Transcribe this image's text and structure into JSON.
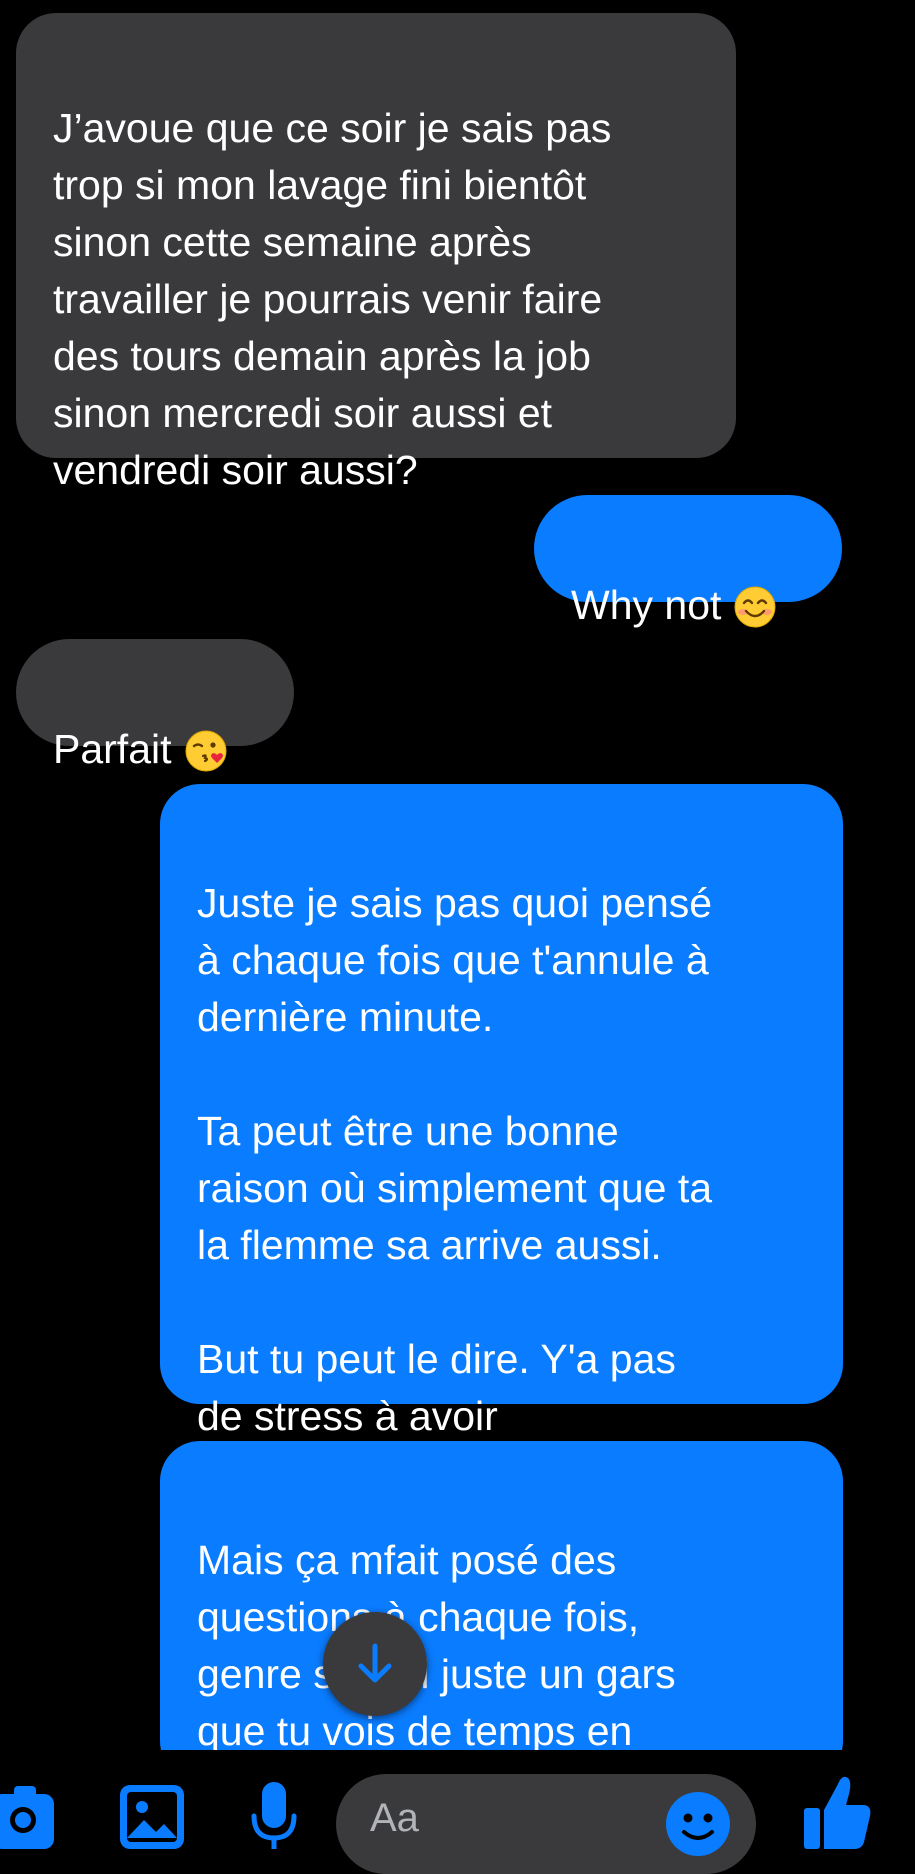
{
  "messages": [
    {
      "id": "m1",
      "direction": "incoming",
      "text": "J’avoue que ce soir je sais pas\ntrop si mon lavage fini bientôt\nsinon cette semaine après\ntravailler je pourrais venir faire\ndes tours demain après la job\nsinon mercredi soir aussi et\nvendredi soir aussi?"
    },
    {
      "id": "m2",
      "direction": "outgoing",
      "text": "Why not",
      "emoji": "smiling-face-emoji"
    },
    {
      "id": "m3",
      "direction": "incoming",
      "text": "Parfait",
      "emoji": "face-blowing-kiss-emoji"
    },
    {
      "id": "m4",
      "direction": "outgoing",
      "text": "Juste je sais pas quoi pensé\nà chaque fois que t'annule à\ndernière minute.\n\nTa peut être une bonne\nraison où simplement que ta\nla flemme sa arrive aussi.\n\nBut tu peut le dire. Y'a pas\nde stress à avoir"
    },
    {
      "id": "m5",
      "direction": "outgoing",
      "text": "Mais ça mfait posé des\nquestions à chaque fois,\ngenre si chui juste un gars\nque tu vois de temps en\ntemps pour fourré that's it."
    }
  ],
  "scroll_button": {
    "icon": "arrow-down-icon"
  },
  "composer": {
    "placeholder": "Aa",
    "icons": [
      "camera-icon",
      "photo-icon",
      "microphone-icon",
      "emoji-icon",
      "thumbs-up-icon"
    ]
  },
  "colors": {
    "background": "#000000",
    "incoming_bubble": "#3a3a3c",
    "outgoing_bubble": "#0a7cff",
    "accent": "#0a7cff",
    "text": "#ffffff"
  }
}
